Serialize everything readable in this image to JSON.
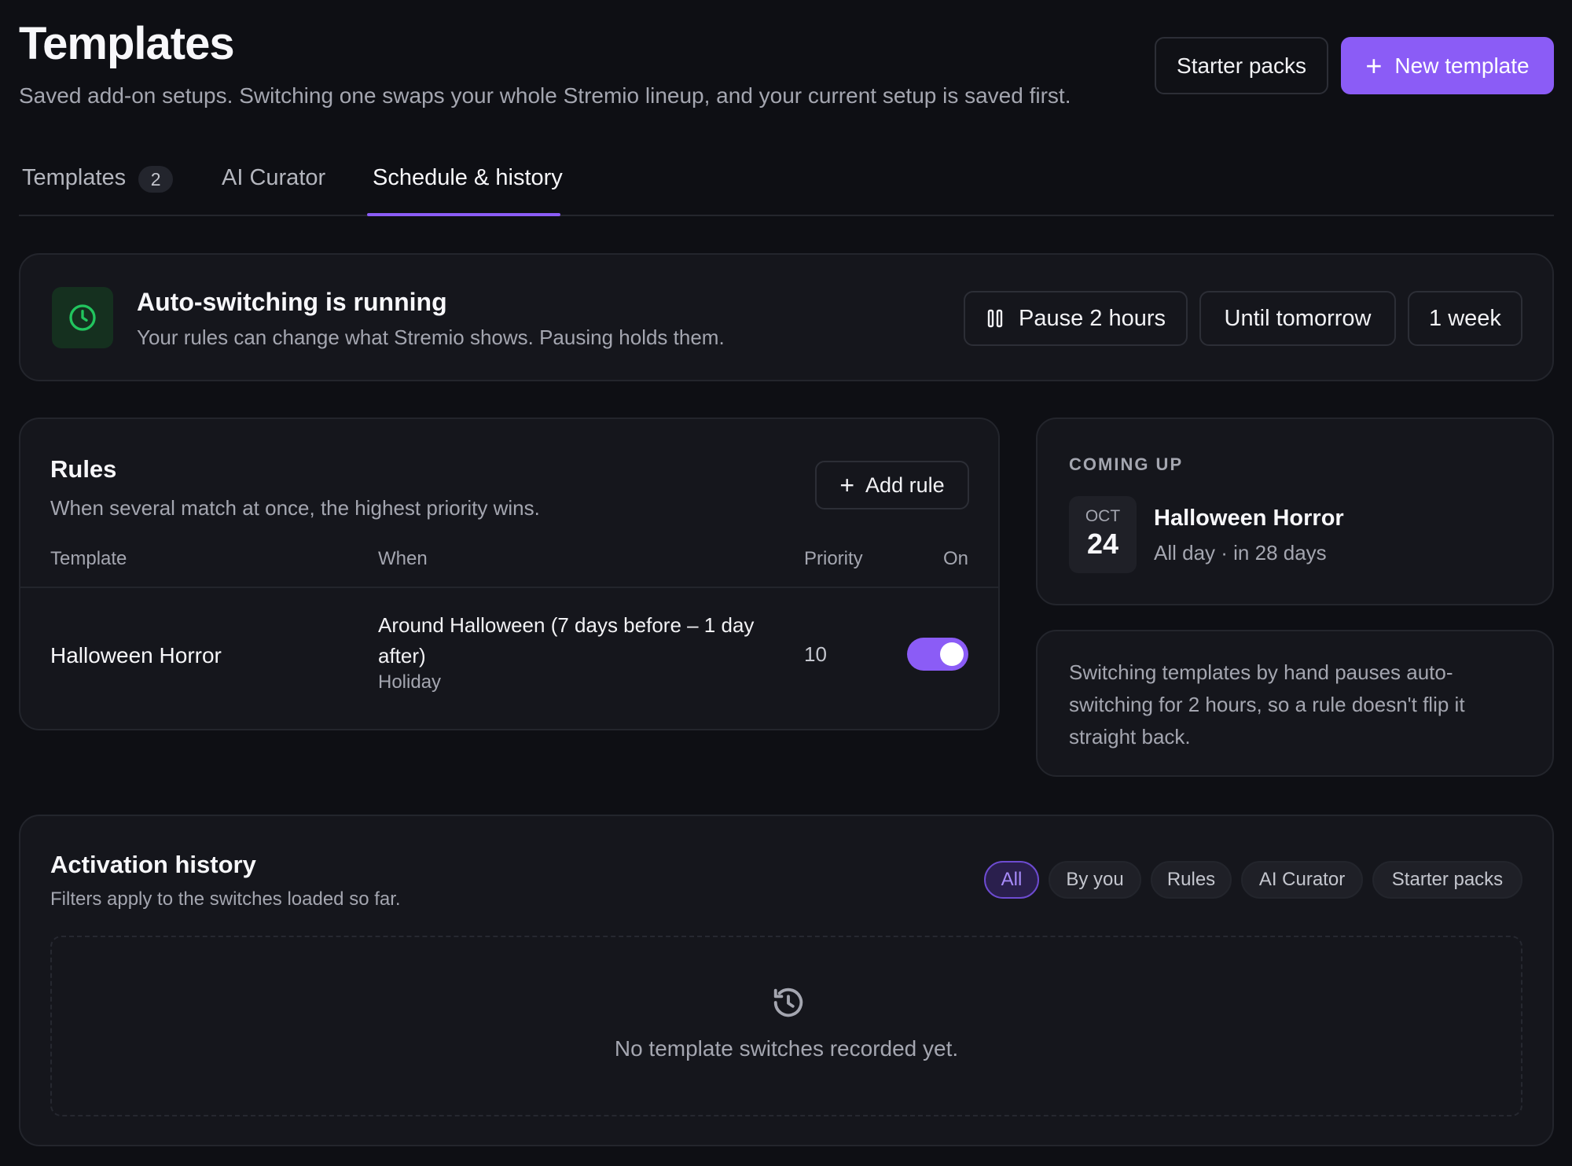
{
  "header": {
    "title": "Templates",
    "subtitle": "Saved add-on setups. Switching one swaps your whole Stremio lineup, and your current setup is saved first.",
    "starter_packs_label": "Starter packs",
    "new_template_label": "New template"
  },
  "tabs": [
    {
      "label": "Templates",
      "badge": "2"
    },
    {
      "label": "AI Curator"
    },
    {
      "label": "Schedule & history",
      "active": true
    }
  ],
  "status": {
    "title": "Auto-switching is running",
    "subtitle": "Your rules can change what Stremio shows. Pausing holds them.",
    "icon": "clock-icon",
    "buttons": [
      "Pause 2 hours",
      "Until tomorrow",
      "1 week"
    ]
  },
  "rules": {
    "title": "Rules",
    "subtitle": "When several match at once, the highest priority wins.",
    "add_label": "Add rule",
    "columns": [
      "Template",
      "When",
      "Priority",
      "On"
    ],
    "rows": [
      {
        "template": "Halloween Horror",
        "when": "Around Halloween (7 days before – 1 day after)",
        "kind": "Holiday",
        "priority": "10",
        "enabled": true
      }
    ]
  },
  "coming_up": {
    "label": "COMING UP",
    "month": "OCT",
    "day": "24",
    "title": "Halloween Horror",
    "subtitle": "All day · in 28 days"
  },
  "note": {
    "text": "Switching templates by hand pauses auto-switching for 2 hours, so a rule doesn't flip it straight back."
  },
  "history": {
    "title": "Activation history",
    "subtitle": "Filters apply to the switches loaded so far.",
    "filters": [
      "All",
      "By you",
      "Rules",
      "AI Curator",
      "Starter packs"
    ],
    "active_filter": "All",
    "empty_text": "No template switches recorded yet."
  },
  "colors": {
    "accent": "#8b5cf6",
    "success": "#22c55e",
    "background": "#0e0f14",
    "card": "#15161c"
  }
}
